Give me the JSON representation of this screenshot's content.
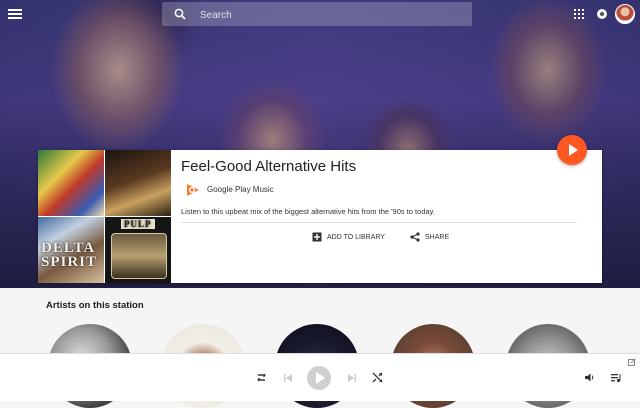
{
  "header": {
    "search_placeholder": "Search",
    "menu_icon": "hamburger-menu-icon",
    "apps_icon": "apps-grid-icon",
    "notification_icon": "notification-icon",
    "avatar_icon": "user-avatar"
  },
  "station": {
    "title": "Feel-Good Alternative Hits",
    "provider": "Google Play Music",
    "description": "Listen to this upbeat mix of the biggest alternative hits from the '90s to today.",
    "add_label": "ADD TO LIBRARY",
    "share_label": "SHARE",
    "album_tiles": [
      "",
      "",
      "DELTA SPIRIT",
      "PULP"
    ]
  },
  "artists_section": {
    "title": "Artists on this station",
    "artists": [
      "",
      "",
      "",
      "",
      ""
    ]
  },
  "player": {
    "repeat_icon": "repeat-icon",
    "prev_icon": "skip-previous-icon",
    "play_icon": "play-icon",
    "next_icon": "skip-next-icon",
    "shuffle_icon": "shuffle-icon",
    "volume_icon": "volume-icon",
    "queue_icon": "queue-icon"
  },
  "colors": {
    "accent": "#fe5722",
    "text": "#212121"
  }
}
